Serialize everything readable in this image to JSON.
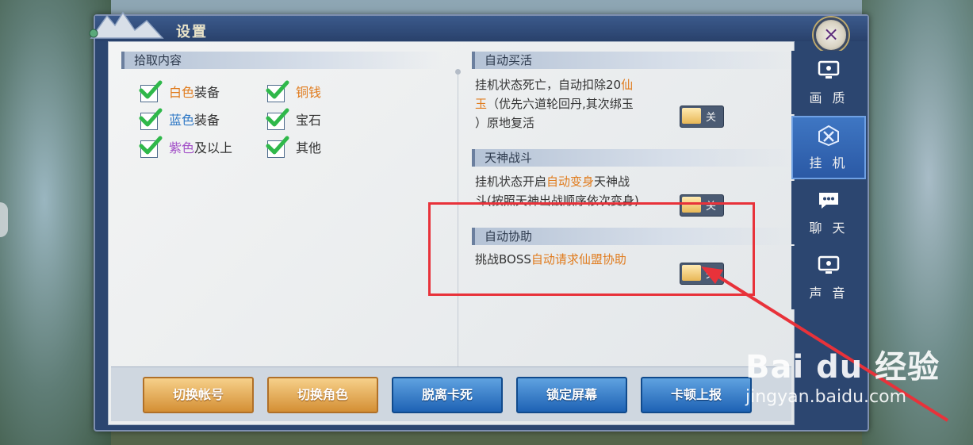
{
  "window": {
    "title": "设置",
    "close_icon": "×"
  },
  "pickup": {
    "header": "拾取内容",
    "items": [
      {
        "color_word": "白色",
        "rest": "装备",
        "color": "#e07b1d"
      },
      {
        "color_word": "铜钱",
        "rest": "",
        "color": "#e07b1d"
      },
      {
        "color_word": "蓝色",
        "rest": "装备",
        "color": "#2e78c5"
      },
      {
        "color_word": "",
        "rest": "宝石",
        "color": "#333333"
      },
      {
        "color_word": "紫色",
        "rest": "及以上",
        "color": "#a351c8"
      },
      {
        "color_word": "",
        "rest": "其他",
        "color": "#333333"
      }
    ]
  },
  "settings": {
    "auto_revive": {
      "header": "自动买活",
      "line1_a": "挂机状态死亡，自动扣除20",
      "line1_b": "仙",
      "line2_a": "玉",
      "line2_b": "（优先六道轮回丹,其次绑玉",
      "line3": "）原地复活",
      "toggle": "关"
    },
    "god_battle": {
      "header": "天神战斗",
      "line1_a": "挂机状态开启",
      "line1_b": "自动变身",
      "line1_c": "天神战",
      "line2": "斗(按照天神出战顺序依次变身)",
      "toggle": "关"
    },
    "auto_assist": {
      "header": "自动协助",
      "line1_a": "挑战BOSS",
      "line1_b": "自动请求仙盟协助",
      "toggle": "关"
    }
  },
  "footer": {
    "buttons": [
      "切换帐号",
      "切换角色",
      "脱离卡死",
      "锁定屏幕",
      "卡顿上报"
    ]
  },
  "tabs": [
    {
      "label": "画 质",
      "icon": "monitor-icon"
    },
    {
      "label": "挂 机",
      "icon": "auto-battle-icon",
      "active": true
    },
    {
      "label": "聊 天",
      "icon": "chat-icon"
    },
    {
      "label": "声 音",
      "icon": "sound-icon"
    }
  ],
  "watermark": {
    "brand": "Bai du 经验",
    "url": "jingyan.baidu.com"
  },
  "colors": {
    "accent_orange": "#e07b1d",
    "highlight_red": "#e8323a",
    "tab_active": "#3f77c4"
  }
}
